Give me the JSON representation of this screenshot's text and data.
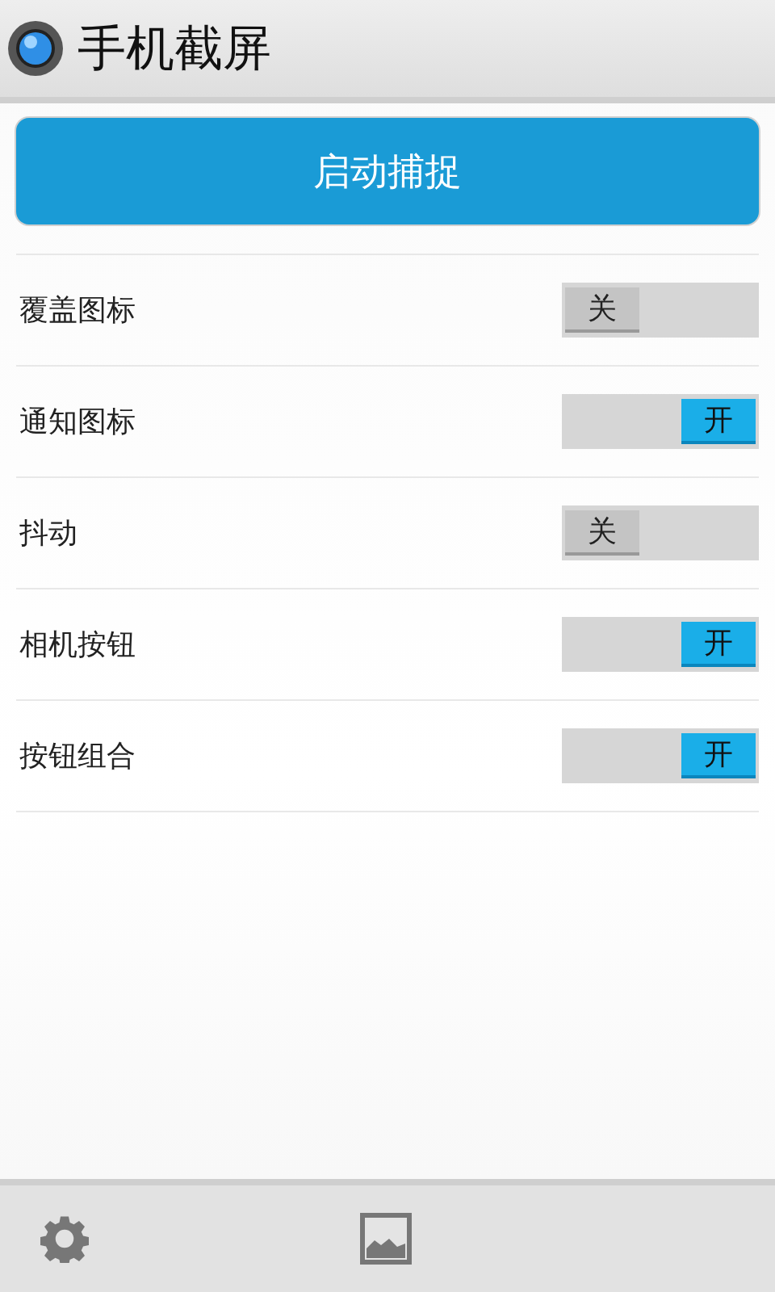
{
  "header": {
    "title": "手机截屏"
  },
  "primary_button": {
    "label": "启动捕捉"
  },
  "settings": [
    {
      "label": "覆盖图标",
      "on": false,
      "switch_text": "关"
    },
    {
      "label": "通知图标",
      "on": true,
      "switch_text": "开"
    },
    {
      "label": "抖动",
      "on": false,
      "switch_text": "关"
    },
    {
      "label": "相机按钮",
      "on": true,
      "switch_text": "开"
    },
    {
      "label": "按钮组合",
      "on": true,
      "switch_text": "开"
    }
  ]
}
